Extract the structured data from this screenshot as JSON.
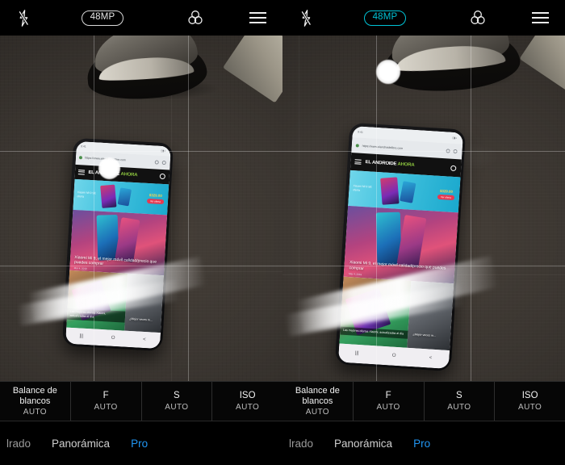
{
  "app": {
    "name": "Camera",
    "comparison": "side-by-side viewfinder comparison, 48MP off (left) vs 48MP on (right)"
  },
  "panels": [
    {
      "id": "left",
      "topbar": {
        "flash_icon": "flash-off-icon",
        "megapixel_badge": "48MP",
        "megapixel_active": false,
        "filters_icon": "filters-icon",
        "menu_icon": "hamburger-menu-icon"
      },
      "viewfinder": {
        "grid": "rule-of-thirds",
        "scene": "smartphone on dark tiled floor with shoe above"
      },
      "phone_screen": {
        "status_time": "9:41",
        "url": "https://www.elandroidelibre.com",
        "site_logo_primary": "EL ANDROIDE",
        "site_logo_accent": "AHORA",
        "banner_text": "Xiaomi\nMi 9 SE\noferta",
        "banner_price": "$329.00",
        "banner_button": "Ver oferta",
        "hero_headline": "Xiaomi Mi 9, el mejor móvil calidad/precio que puedes comprar",
        "hero_date": "Mar 4, 2019",
        "article2_caption": "Las mejores ofertas Xiaomi, actualizadas al día",
        "article2_caption2": "¿Mejor veces m...",
        "nav_recents": "|||",
        "nav_home": "O",
        "nav_back": "<"
      },
      "pro_controls": [
        {
          "label": "Balance de blancos",
          "value": "AUTO",
          "name": "white-balance"
        },
        {
          "label": "F",
          "value": "AUTO",
          "name": "aperture"
        },
        {
          "label": "S",
          "value": "AUTO",
          "name": "shutter-speed"
        },
        {
          "label": "ISO",
          "value": "AUTO",
          "name": "iso"
        }
      ],
      "modes": [
        {
          "label": "lrado",
          "active": false,
          "clipped": true
        },
        {
          "label": "Panorámica",
          "active": false,
          "clipped": false
        },
        {
          "label": "Pro",
          "active": true,
          "clipped": false
        }
      ]
    },
    {
      "id": "right",
      "topbar": {
        "flash_icon": "flash-off-icon",
        "megapixel_badge": "48MP",
        "megapixel_active": true,
        "filters_icon": "filters-icon",
        "menu_icon": "hamburger-menu-icon"
      },
      "viewfinder": {
        "grid": "rule-of-thirds",
        "scene": "smartphone on dark tiled floor with shoe above, tighter crop"
      },
      "phone_screen": {
        "status_time": "9:41",
        "url": "https://www.elandroidelibre.com",
        "site_logo_primary": "EL ANDROIDE",
        "site_logo_accent": "AHORA",
        "banner_text": "Xiaomi\nMi 9 SE\noferta",
        "banner_price": "$329.00",
        "banner_button": "Ver oferta",
        "hero_headline": "Xiaomi Mi 9, el mejor móvil calidad/precio que puedes comprar",
        "hero_date": "Mar 4, 2019",
        "article2_caption": "Las mejores ofertas Xiaomi, actualizadas al día",
        "article2_caption2": "¿Mejor veces m...",
        "nav_recents": "|||",
        "nav_home": "O",
        "nav_back": "<"
      },
      "pro_controls": [
        {
          "label": "Balance de blancos",
          "value": "AUTO",
          "name": "white-balance"
        },
        {
          "label": "F",
          "value": "AUTO",
          "name": "aperture"
        },
        {
          "label": "S",
          "value": "AUTO",
          "name": "shutter-speed"
        },
        {
          "label": "ISO",
          "value": "AUTO",
          "name": "iso"
        }
      ],
      "modes": [
        {
          "label": "lrado",
          "active": false,
          "clipped": true
        },
        {
          "label": "Panorámica",
          "active": false,
          "clipped": false
        },
        {
          "label": "Pro",
          "active": true,
          "clipped": false
        }
      ]
    }
  ],
  "colors": {
    "badge_active": "#00c3d6",
    "badge_inactive": "#e8e8e8",
    "mode_active": "#2196f3",
    "mode_inactive": "#cfcfcf",
    "bar_background": "#000000",
    "floor": "#3b3631"
  }
}
